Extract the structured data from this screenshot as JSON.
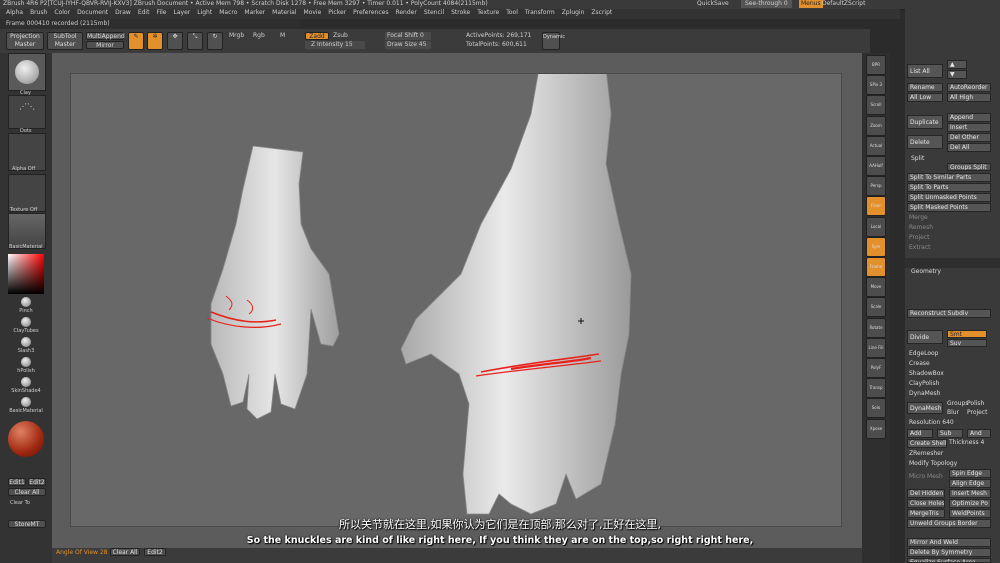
{
  "window_title": "ZBrush 4R6 P2[TCUJ-IYHF-QBVR-RVIJ-KXV3]  ZBrush Document  • Active Mem 798 • Scratch Disk 1278 • Free Mem 3297 • Timer 0.011 • PolyCount 4084(2115mb)",
  "quicksave": "QuickSave",
  "see_through": "See-through 0",
  "menus_label": "Menus",
  "default_script": "DefaultZScript",
  "menu_items": [
    "Alpha",
    "Brush",
    "Color",
    "Document",
    "Draw",
    "Edit",
    "File",
    "Layer",
    "Light",
    "Macro",
    "Marker",
    "Material",
    "Movie",
    "Picker",
    "Preferences",
    "Render",
    "Stencil",
    "Stroke",
    "Texture",
    "Tool",
    "Transform",
    "Zplugin",
    "Zscript"
  ],
  "frame_label": "Frame 000410 recorded (2115mb)",
  "toolbar": {
    "projection_master": "Projection Master",
    "subtool_master": "SubTool Master",
    "multi_append": "MultiAppend",
    "mirror": "Mirror",
    "edit": "Edit",
    "draw": "Draw",
    "move": "Move",
    "scale": "Scale",
    "rotate": "Rotate",
    "mrgb": "Mrgb",
    "rgb": "Rgb",
    "m": "M",
    "zadd": "Zadd",
    "zsub": "Zsub",
    "z_intensity": "Z Intensity 15",
    "focal_shift": "Focal Shift 0",
    "draw_size": "Draw Size 45",
    "active_points": "ActivePoints: 269,171",
    "total_points": "TotalPoints: 600,611",
    "dynamic": "Dynamic"
  },
  "left_shelf": {
    "brush_label": "Clay",
    "stroke_label": "Dots",
    "alpha_label": "Alpha Off",
    "texture_label": "Texture Off",
    "material_label": "BasicMaterial",
    "brushes": [
      "Pinch",
      "ClayTubes",
      "Slash3",
      "hPolish",
      "SkinShade4",
      "BasicMaterial"
    ],
    "rgb_buttons": [
      "Edit1",
      "Edit2"
    ],
    "clear_all": "Clear All",
    "clear_to": "Clear To",
    "store_mt": "StoreMT"
  },
  "right_shelf_labels": [
    "BPR",
    "SPix 3",
    "Scroll",
    "Zoom",
    "Actual",
    "AAHalf",
    "Persp",
    "Floor",
    "Local",
    "Sym",
    "Frame",
    "Move",
    "Scale",
    "Rotate",
    "Line Fill",
    "PolyF",
    "Transp",
    "Solo",
    "Xpose"
  ],
  "panel": {
    "list_all": "List All",
    "rename": "Rename",
    "auto_reorder": "AutoReorder",
    "all_low": "All Low",
    "all_high": "All High",
    "duplicate": "Duplicate",
    "append": "Append",
    "insert": "Insert",
    "delete": "Delete",
    "del_other": "Del Other",
    "del_all": "Del All",
    "split_header": "Split",
    "groups_split": "Groups Split",
    "split_to_similar": "Split To Similar Parts",
    "split_to_parts": "Split To Parts",
    "split_unmasked": "Split Unmasked Points",
    "split_masked": "Split Masked Points",
    "merge": "Merge",
    "remesh": "Remesh",
    "project": "Project",
    "extract": "Extract",
    "geometry_header": "Geometry",
    "reconstruct_subdiv": "Reconstruct Subdiv",
    "divide": "Divide",
    "smt": "Smt",
    "suv": "Suv",
    "edgeloop": "EdgeLoop",
    "crease": "Crease",
    "shadowbox": "ShadowBox",
    "claypolish": "ClayPolish",
    "dynamesh_header": "DynaMesh",
    "dynamesh": "DynaMesh",
    "groups": "Groups",
    "polish": "Polish",
    "blur": "Blur",
    "project2": "Project",
    "resolution": "Resolution 640",
    "add": "Add",
    "sub": "Sub",
    "and": "And",
    "create_shell": "Create Shell",
    "thickness": "Thickness 4",
    "zremesher": "ZRemesher",
    "modify_topology": "Modify Topology",
    "micro_mesh": "Micro Mesh",
    "spin_edge": "Spin Edge",
    "align_edge": "Align Edge",
    "del_hidden": "Del Hidden",
    "insert_mesh": "Insert Mesh",
    "close_holes": "Close Holes",
    "optimize_points": "Optimize Po",
    "merge_tris": "MergeTris",
    "weld_points": "WeldPoints",
    "unweld_groups_border": "Unweld Groups Border",
    "mirror_and_weld": "Mirror And Weld",
    "delete_by_symmetry": "Delete By Symmetry",
    "equalize_surface": "Equalize Surface Area"
  },
  "bottom_bar": {
    "angle_of_view": "Angle Of View 28",
    "clear_all": "Clear All",
    "edit2": "Edit2"
  },
  "subtitle_zh": "所以关节就在这里,如果你认为它们是在顶部,那么对了,正好在这里,",
  "subtitle_en": "So the knuckles are kind of like right here, If you think they are on the top,so right right here,",
  "colors": {
    "accent_orange": "#e2902c",
    "stroke_red": "#e8211c",
    "canvas_gray": "#686868"
  }
}
